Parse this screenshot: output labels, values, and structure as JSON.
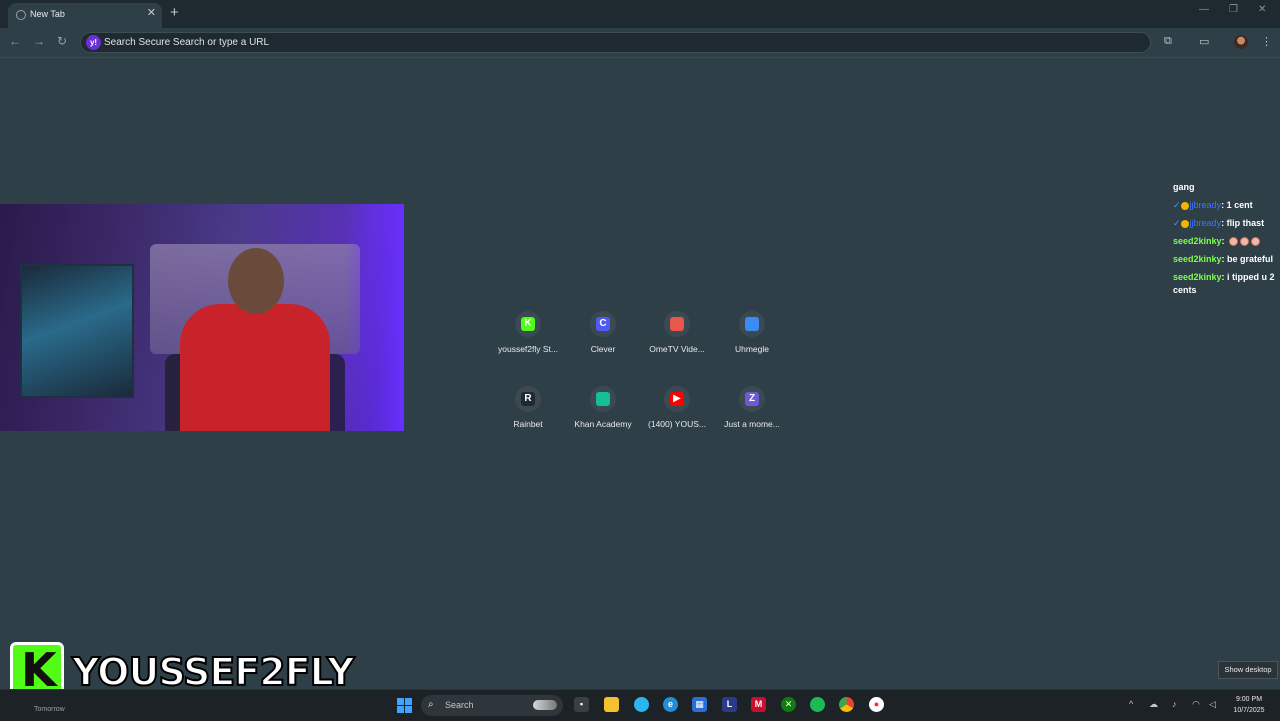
{
  "browser": {
    "tab_title": "New Tab",
    "omnibox_placeholder": "Search Secure Search or type a URL",
    "omnibox_icon_letter": "y!"
  },
  "shortcuts": [
    {
      "label": "youssef2fly St...",
      "icon": "kick-icon",
      "glyph": "K",
      "color": "#53fc18"
    },
    {
      "label": "Clever",
      "icon": "clever-icon",
      "glyph": "C",
      "color": "#4d5bf2"
    },
    {
      "label": "OmeTV Vide...",
      "icon": "ometv-icon",
      "glyph": "",
      "color": "#e8574a"
    },
    {
      "label": "Uhmegle",
      "icon": "chat-bubble-icon",
      "glyph": "",
      "color": "#3a8cf5"
    },
    {
      "label": "Rainbet",
      "icon": "rainbet-icon",
      "glyph": "R",
      "color": "#1f2a30"
    },
    {
      "label": "Khan Academy",
      "icon": "khan-academy-icon",
      "glyph": "",
      "color": "#14bf96"
    },
    {
      "label": "(1400) YOUS...",
      "icon": "youtube-icon",
      "glyph": "▶",
      "color": "#ff0000"
    },
    {
      "label": "Just a mome...",
      "icon": "loading-icon",
      "glyph": "Z",
      "color": "#6b5ad6"
    }
  ],
  "chat": {
    "messages": [
      {
        "user": "",
        "text": "gang",
        "emotes": 0
      },
      {
        "user": "jjbready",
        "text": "1 cent",
        "emotes": 0
      },
      {
        "user": "jjbready",
        "text": "flip thast",
        "emotes": 0
      },
      {
        "user": "seed2kinky",
        "text": "",
        "emotes": 3
      },
      {
        "user": "seed2kinky",
        "text": "be grateful",
        "emotes": 0
      },
      {
        "user": "seed2kinky",
        "text": "i tipped u 2 cents",
        "emotes": 0
      }
    ]
  },
  "overlay": {
    "brand_letter": "K",
    "streamer_name": "YOUSSEF2FLY"
  },
  "desktop": {
    "show_desktop_label": "Show desktop",
    "weather_text": "Tomorrow"
  },
  "taskbar": {
    "search_placeholder": "Search",
    "time": "9:00 PM",
    "date": "10/7/2025"
  }
}
